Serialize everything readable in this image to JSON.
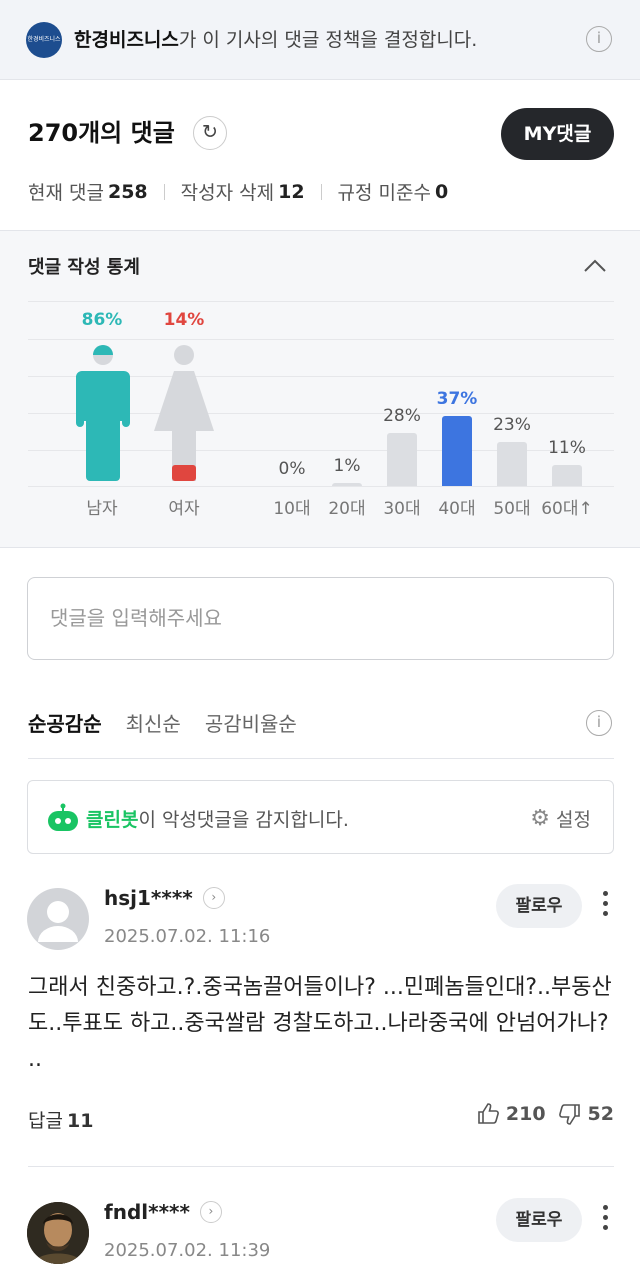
{
  "policy": {
    "logo_text": "한경비즈니스",
    "brand": "한경비즈니스",
    "message": "가 이 기사의 댓글 정책을 결정합니다."
  },
  "header": {
    "title": "270개의 댓글",
    "my_button": "MY댓글",
    "current_label": "현재 댓글",
    "current_value": "258",
    "deleted_label": "작성자 삭제",
    "deleted_value": "12",
    "violation_label": "규정 미준수",
    "violation_value": "0"
  },
  "stats": {
    "title": "댓글 작성 통계",
    "gender": [
      {
        "label": "남자",
        "percent": "86%",
        "value": 86,
        "color": "#2db8b6"
      },
      {
        "label": "여자",
        "percent": "14%",
        "value": 14,
        "color": "#e0463f"
      }
    ],
    "age": [
      {
        "label": "10대",
        "percent": "0%",
        "value": 0
      },
      {
        "label": "20대",
        "percent": "1%",
        "value": 1
      },
      {
        "label": "30대",
        "percent": "28%",
        "value": 28
      },
      {
        "label": "40대",
        "percent": "37%",
        "value": 37,
        "highlight": true
      },
      {
        "label": "50대",
        "percent": "23%",
        "value": 23
      },
      {
        "label": "60대↑",
        "percent": "11%",
        "value": 11
      }
    ],
    "colors": {
      "bar": "#dcdee2",
      "highlight": "#3d75e0",
      "male": "#2db8b6",
      "female": "#e0463f"
    }
  },
  "input": {
    "placeholder": "댓글을 입력해주세요"
  },
  "tabs": [
    "순공감순",
    "최신순",
    "공감비율순"
  ],
  "cleanbot": {
    "brand": "클린봇",
    "message": "이 악성댓글을 감지합니다.",
    "settings": "설정"
  },
  "comments": [
    {
      "user": "hsj1****",
      "date": "2025.07.02. 11:16",
      "follow": "팔로우",
      "text": "그래서 친중하고.?.중국놈끌어들이나? ...민폐놈들인대?..부동산도..투표도 하고..중국쌀람 경찰도하고..나라중국에 안넘어가나? ..",
      "reply_label": "답글",
      "reply_count": "11",
      "likes": "210",
      "dislikes": "52"
    },
    {
      "user": "fndl****",
      "date": "2025.07.02. 11:39",
      "follow": "팔로우"
    }
  ]
}
